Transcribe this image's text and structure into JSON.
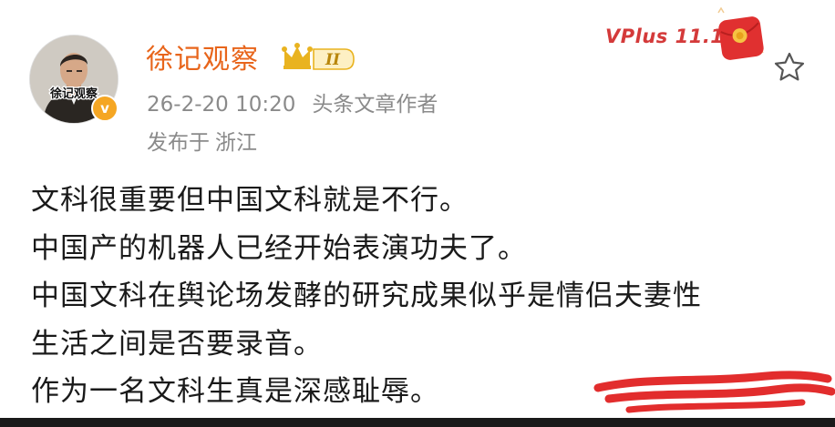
{
  "author": {
    "name": "徐记观察",
    "avatar_caption": "徐记观察",
    "verify_mark": "v",
    "level_badge": "II"
  },
  "post": {
    "timestamp": "26-2-20 10:20",
    "source": "头条文章作者",
    "location_prefix": "发布于",
    "location": "浙江",
    "lines": [
      "文科很重要但中国文科就是不行。",
      "中国产的机器人已经开始表演功夫了。",
      "中国文科在舆论场发酵的研究成果似乎是情侣夫妻性",
      "生活之间是否要录音。",
      "作为一名文科生真是深感耻辱。"
    ]
  },
  "promo": {
    "label": "VPlus 11.11",
    "icon": "red-packet-icon"
  },
  "actions": {
    "favorite_icon": "star-icon"
  },
  "colors": {
    "name": "#e8651b",
    "meta": "#8a8a8a",
    "promo": "#d43a3a",
    "scribble": "#e22d2d"
  }
}
